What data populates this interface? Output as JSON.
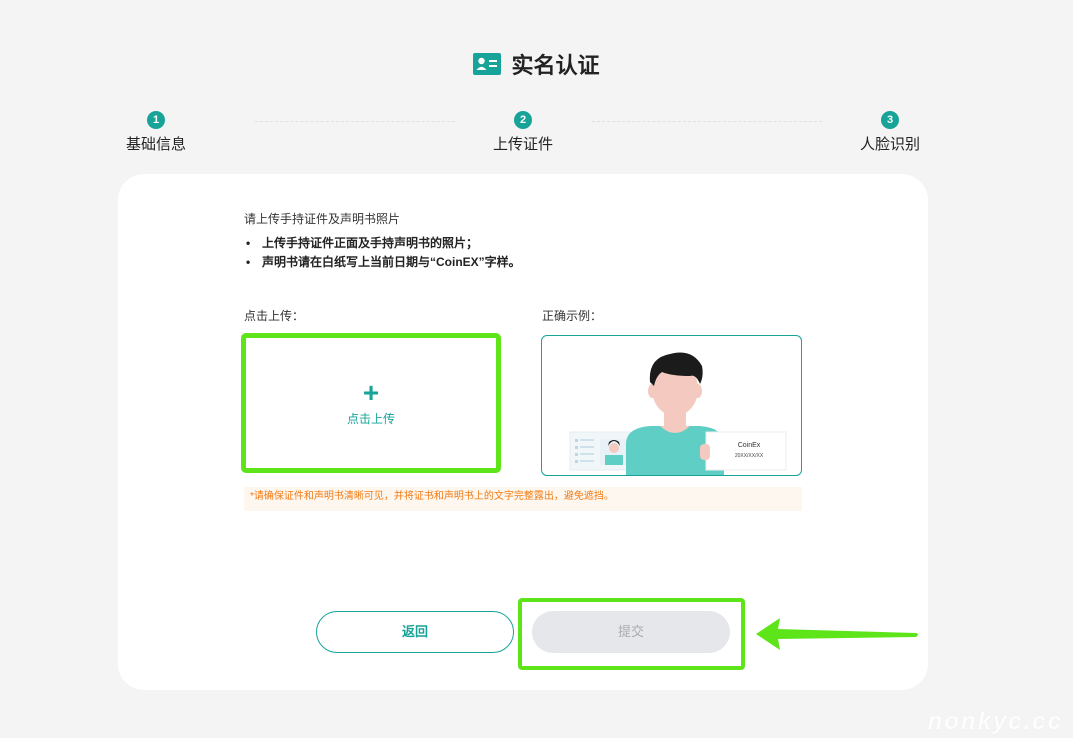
{
  "header": {
    "title": "实名认证",
    "icon": "id-card-icon"
  },
  "steps": [
    {
      "num": "1",
      "label": "基础信息"
    },
    {
      "num": "2",
      "label": "上传证件"
    },
    {
      "num": "3",
      "label": "人脸识别"
    }
  ],
  "instructions": {
    "intro": "请上传手持证件及声明书照片",
    "bullets": [
      "上传手持证件正面及手持声明书的照片；",
      "声明书请在白纸写上当前日期与“CoinEX”字样。"
    ]
  },
  "upload": {
    "label": "点击上传：",
    "plus": "+",
    "button_text": "点击上传"
  },
  "example": {
    "label": "正确示例：",
    "paper_line1": "CoinEx",
    "paper_line2": "20XX/XX/XX"
  },
  "warning": "*请确保证件和声明书清晰可见，并将证书和声明书上的文字完整露出，避免遮挡。",
  "actions": {
    "back_label": "返回",
    "submit_label": "提交"
  },
  "watermark": "nonkyc.cc",
  "colors": {
    "accent": "#17a398",
    "highlight": "#5ee51a",
    "warning": "#f07b14"
  }
}
